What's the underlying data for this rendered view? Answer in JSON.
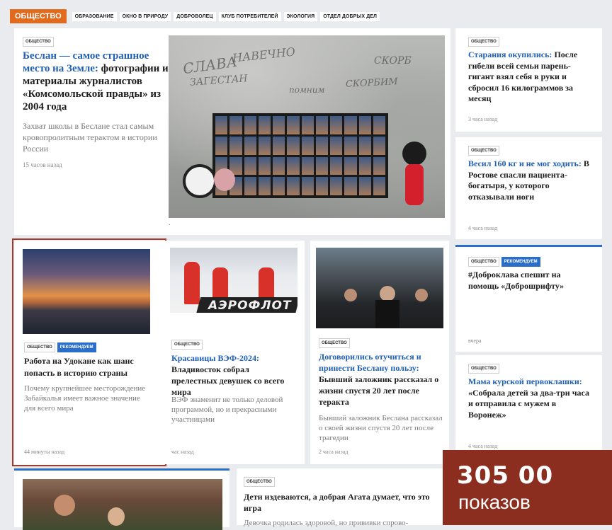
{
  "nav": {
    "section": "ОБЩЕСТВО",
    "items": [
      "ОБРАЗОВАНИЕ",
      "ОКНО В ПРИРОДУ",
      "ДОБРОВОЛЕЦ",
      "КЛУБ ПОТРЕБИТЕЛЕЙ",
      "ЭКОЛОГИЯ",
      "ОТДЕЛ ДОБРЫХ ДЕЛ"
    ]
  },
  "main_article": {
    "tag": "ОБЩЕСТВО",
    "title_blue": "Беслан — самое страшное место на Земле:",
    "title_black": " фотографии и материалы журналистов «Комсомольской правды» из 2004 года",
    "lead": "Захват школы в Беслане стал самым кровопролитным терактом в истории России",
    "time": "15 часов назад",
    "image_caption": "."
  },
  "right_column": [
    {
      "tag": "ОБЩЕСТВО",
      "title_blue": "Старания окупились:",
      "title_black": " После гибели всей семьи парень-гигант взял себя в руки и сбросил 16 килограммов за месяц",
      "time": "3 часа назад"
    },
    {
      "tag": "ОБЩЕСТВО",
      "title_blue": "Весил 160 кг и не мог ходить:",
      "title_black": " В Ростове спасли пациента-богатыря, у которого отказывали ноги",
      "time": "4 часа назад"
    },
    {
      "tag": "ОБЩЕСТВО",
      "tag2": "РЕКОМЕНДУЕМ",
      "title_black": "#Доброклава спешит на помощь «Доброшрифту»",
      "time": "вчера"
    },
    {
      "tag": "ОБЩЕСТВО",
      "title_blue": "Мама курской первоклашки:",
      "title_black": " «Собрала детей за два-три часа и отправила с мужем в Воронеж»",
      "time": "4 часа назад"
    }
  ],
  "middle_row": [
    {
      "tag": "ОБЩЕСТВО",
      "tag2": "РЕКОМЕНДУЕМ",
      "title_black": "Работа на Удокане как шанс попасть в историю страны",
      "lead": "Почему крупнейшее месторождение Забайкалья имеет важное значение для всего мира",
      "time": "44 минуты назад"
    },
    {
      "tag": "ОБЩЕСТВО",
      "title_blue": "Красавицы ВЭФ-2024:",
      "title_black": " Владивосток собрал прелестных девушек со всего мира",
      "lead": "ВЭФ знаменит не только деловой программой, но и прекрасными участницами",
      "time": "час назад",
      "image_text": "АЭРОФЛОТ"
    },
    {
      "tag": "ОБЩЕСТВО",
      "title_blue": "Договорились отучиться и принести Беслану пользу:",
      "title_black": " Бывший заложник рассказал о жизни спустя 20 лет после теракта",
      "lead": "Бывший заложник Беслана рассказал о своей жизни спустя 20 лет после трагедии",
      "time": "2 часа назад"
    }
  ],
  "bottom": {
    "tag": "ОБЩЕСТВО",
    "title_black": "Дети издеваются, а добрая Агата думает, что это игра",
    "lead": "Девочка родилась здоровой, но прививки спрово-"
  },
  "promo": {
    "number": "305 00",
    "label": "показов"
  },
  "colors": {
    "accent_orange": "#e26a1d",
    "link_blue": "#1f5fb5",
    "tag_blue": "#2a6ec9",
    "highlight_border": "#a8392a",
    "promo_bg": "#8b2e1f"
  }
}
